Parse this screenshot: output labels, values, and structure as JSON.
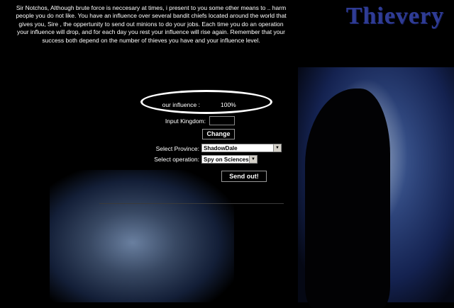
{
  "title": "Thievery",
  "intro": "Sir Notchos, Although brute force is neccesary at times, i present to you some other means to .. harm people you do not like. You have an influence over several bandit chiefs located around the world that gives you, Sire , the oppertunity to send out minions to do your jobs. Each time you do an operation your influence will drop, and for each day you rest your influence will rise again. Remember that your success both depend on the number of thieves you have and your influence level.",
  "form": {
    "influence_label": "our influence :",
    "influence_value": "100%",
    "kingdom_label": "Input Kingdom:",
    "kingdom_value": "",
    "change_button": "Change",
    "province_label": "Select Province:",
    "province_value": "ShadowDale",
    "operation_label": "Select operation:",
    "operation_value": "Spy on Sciences",
    "send_button": "Send out!"
  },
  "colors": {
    "title": "#2f3c95",
    "background": "#000000",
    "highlight_oval": "#ffffff"
  },
  "icons": {
    "dropdown": "chevron-down-icon"
  }
}
